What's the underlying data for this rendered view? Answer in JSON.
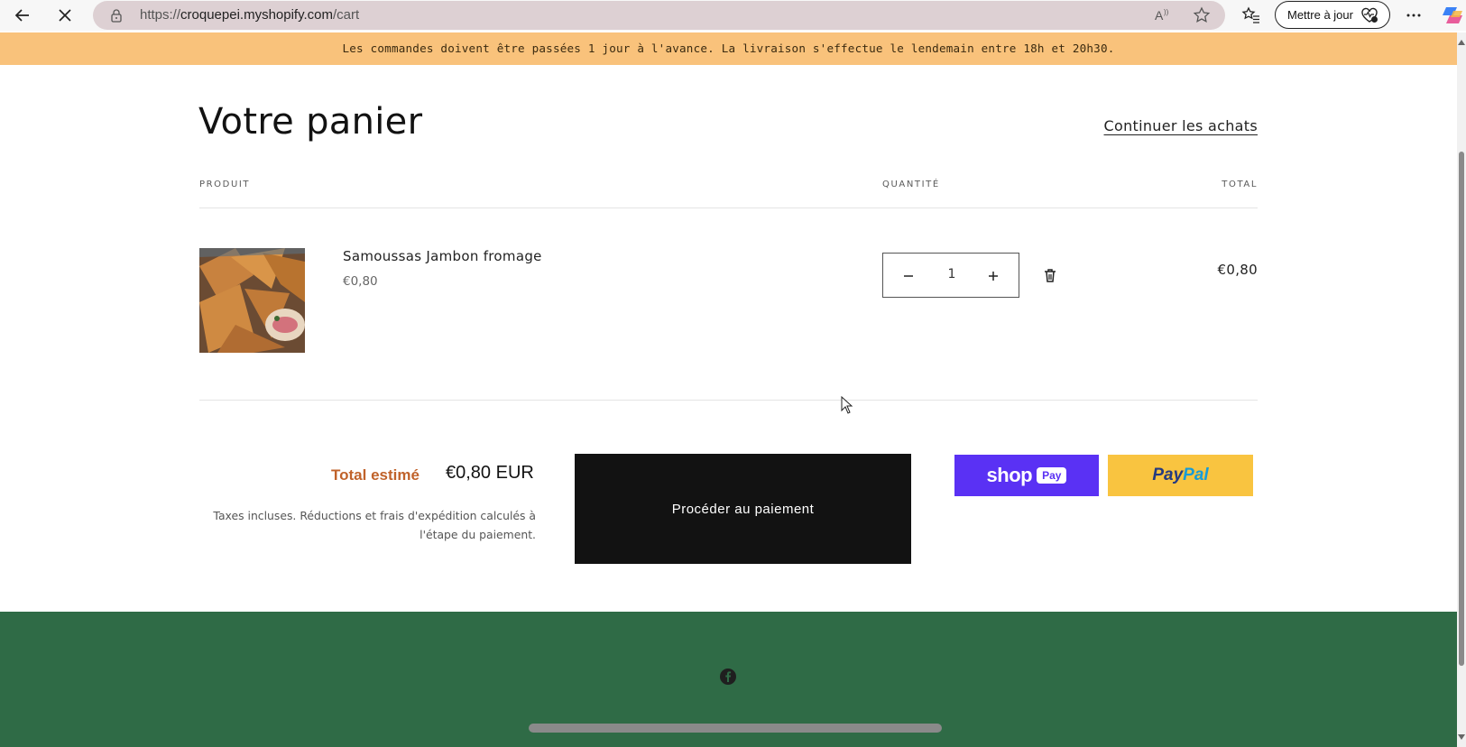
{
  "browser": {
    "url_prefix": "https://",
    "url_domain": "croquepei.myshopify.com",
    "url_path": "/cart",
    "update_button_label": "Mettre à jour",
    "icons": [
      "back-arrow-icon",
      "stop-loading-icon",
      "lock-icon",
      "read-aloud-icon",
      "favorite-star-icon",
      "favorites-list-icon",
      "heart-pulse-icon",
      "more-menu-icon",
      "copilot-icon"
    ]
  },
  "announcement": "Les commandes doivent être passées 1 jour à l'avance. La livraison s'effectue le lendemain entre 18h et 20h30.",
  "cart": {
    "title": "Votre panier",
    "continue_link": "Continuer les achats",
    "columns": {
      "product": "PRODUIT",
      "quantity": "QUANTITÉ",
      "total": "TOTAL"
    },
    "items": [
      {
        "name": "Samoussas Jambon fromage",
        "price": "€0,80",
        "quantity": "1",
        "line_total": "€0,80"
      }
    ]
  },
  "summary": {
    "total_label": "Total estimé",
    "total_value": "€0,80 EUR",
    "tax_note_line1": "Taxes incluses. Réductions et frais d'expédition calculés à",
    "tax_note_line2": "l'étape du paiement.",
    "checkout_label": "Procéder au paiement",
    "shop_pay_word": "shop",
    "shop_pay_badge": "Pay",
    "paypal_part1": "Pay",
    "paypal_part2": "Pal"
  },
  "colors": {
    "announcement_bg": "#f9c27b",
    "footer_bg": "#2f6b46",
    "checkout_bg": "#121212",
    "shop_pay_bg": "#5a31f4",
    "paypal_bg": "#f9c440",
    "total_label": "#c0622a"
  },
  "footer": {
    "social_icons": [
      "facebook-icon"
    ]
  }
}
